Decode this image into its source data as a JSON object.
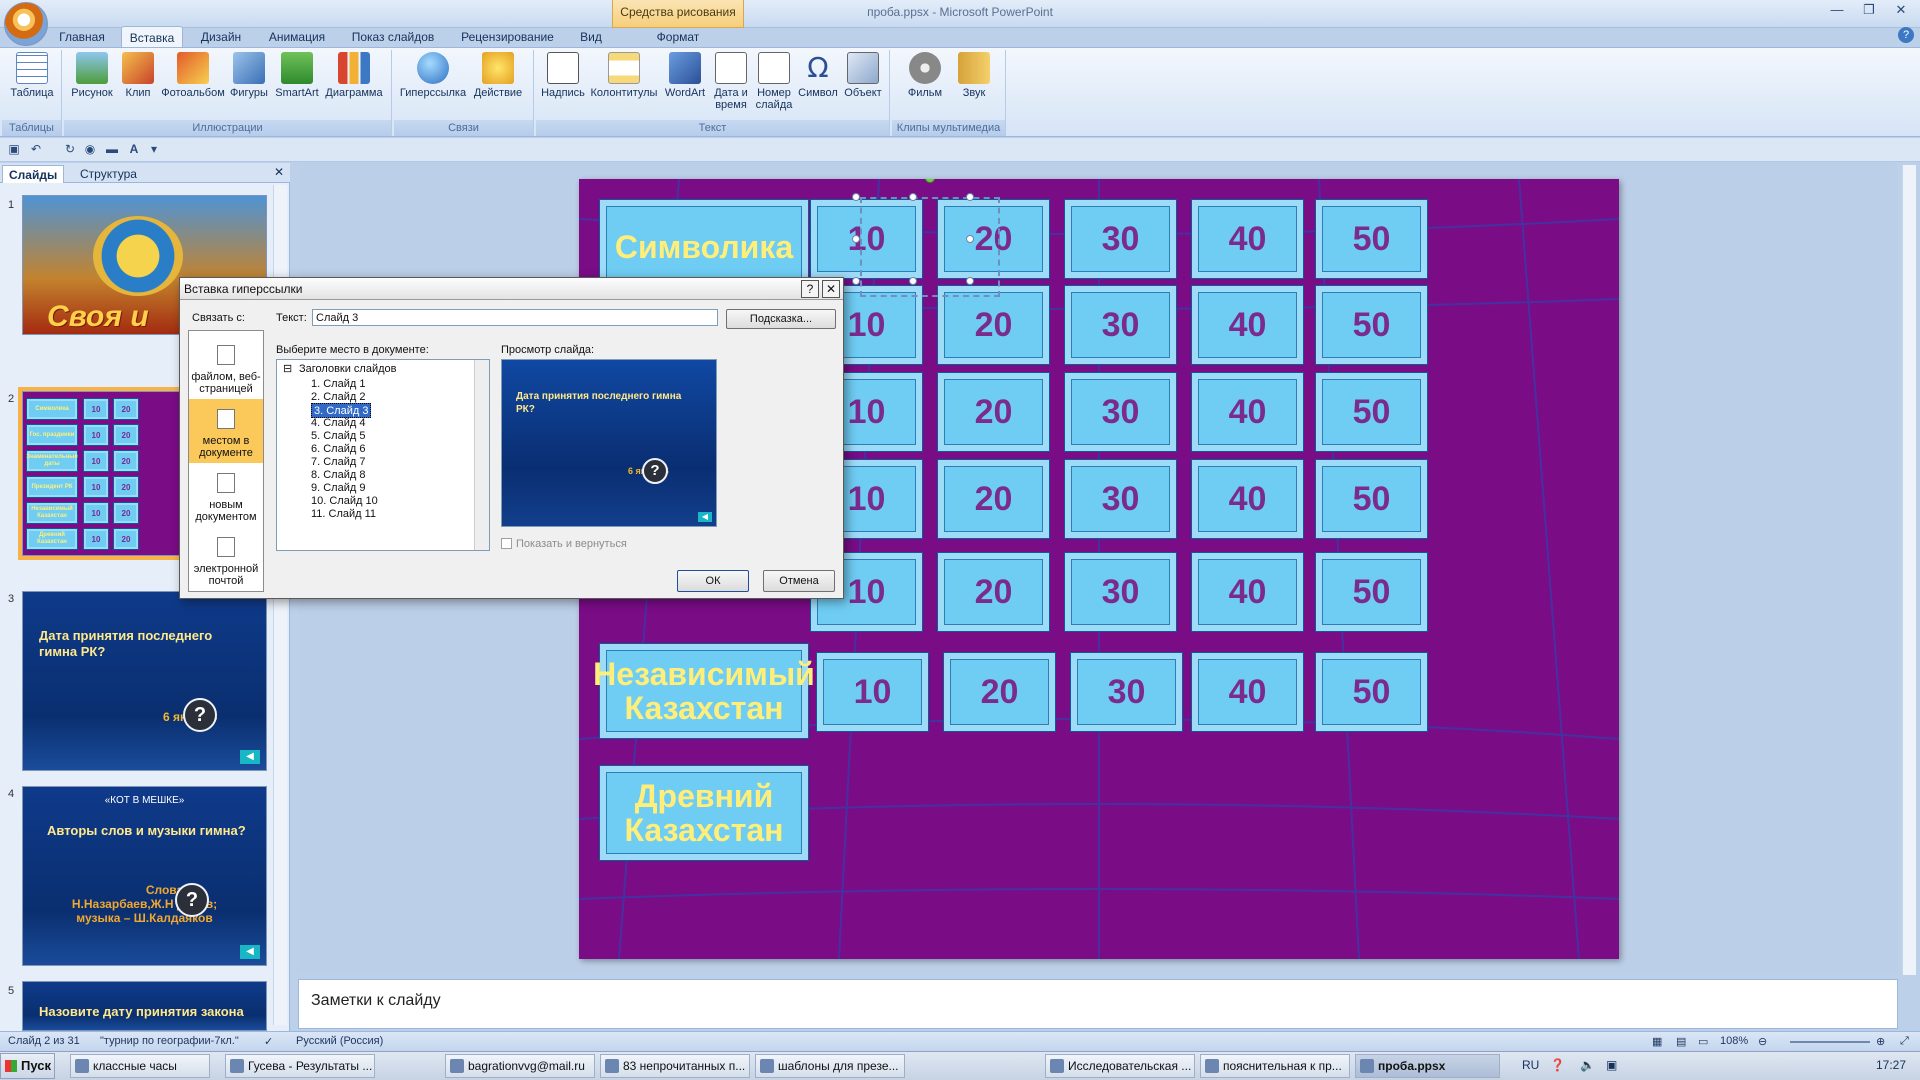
{
  "window": {
    "title": "проба.ppsx - Microsoft PowerPoint",
    "context_tab": "Средства рисования"
  },
  "tabs": [
    "Главная",
    "Вставка",
    "Дизайн",
    "Анимация",
    "Показ слайдов",
    "Рецензирование",
    "Вид",
    "Формат"
  ],
  "ribbon": {
    "groups": {
      "tables": "Таблицы",
      "illustrations": "Иллюстрации",
      "links": "Связи",
      "text": "Текст",
      "media": "Клипы мультимедиа"
    },
    "buttons": {
      "table": "Таблица",
      "picture": "Рисунок",
      "clip": "Клип",
      "photoalbum": "Фотоальбом",
      "shapes": "Фигуры",
      "smartart": "SmartArt",
      "chart": "Диаграмма",
      "hyperlink": "Гиперссылка",
      "action": "Действие",
      "textbox": "Надпись",
      "headerfooter": "Колонтитулы",
      "wordart": "WordArt",
      "datetime_1": "Дата и",
      "datetime_2": "время",
      "slidenumber_1": "Номер",
      "slidenumber_2": "слайда",
      "symbol": "Символ",
      "object": "Объект",
      "movie": "Фильм",
      "sound": "Звук"
    }
  },
  "left_pane": {
    "tabs": [
      "Слайды",
      "Структура"
    ],
    "slide1_banner": "Своя и",
    "slide2_categories": [
      "Символика",
      "Гос. праздники",
      "Знаменательные даты",
      "Президент РК",
      "Независимый Казахстан",
      "Древний Казахстан"
    ],
    "slide2_values": [
      "10",
      "20"
    ],
    "slide3_question": "Дата принятия последнего гимна РК?",
    "slide3_answer": "6 ян  2006",
    "slide4_header": "«КОТ В МЕШКЕ»",
    "slide4_question": "Авторы слов и музыки гимна?",
    "slide4_answer_1": "Слова",
    "slide4_answer_2": "Н.Назарбаев,Ж.Н      денов;",
    "slide4_answer_3": "музыка – Ш.Калдаяков",
    "slide5_text": "Назовите дату принятия закона",
    "question_mark": "?",
    "arrow_glyph": "◀"
  },
  "slide": {
    "categories": [
      "Символика",
      "Независимый Казахстан",
      "Древний Казахстан"
    ],
    "values": [
      "10",
      "20",
      "30",
      "40",
      "50"
    ]
  },
  "notes": {
    "placeholder": "Заметки к слайду"
  },
  "dialog": {
    "title": "Вставка гиперссылки",
    "help": "?",
    "close": "✕",
    "link_with": "Связать с:",
    "link_options": [
      {
        "line1": "файлом, веб-",
        "line2": "страницей"
      },
      {
        "line1": "местом в",
        "line2": "документе"
      },
      {
        "line1": "новым",
        "line2": "документом"
      },
      {
        "line1": "электронной",
        "line2": "почтой"
      }
    ],
    "text_label": "Текст:",
    "text_value": "Слайд 3",
    "screentip": "Подсказка...",
    "place_label": "Выберите место в документе:",
    "preview_label": "Просмотр слайда:",
    "tree_root": "Заголовки слайдов",
    "tree_items": [
      "1. Слайд 1",
      "2. Слайд 2",
      "3. Слайд 3",
      "4. Слайд 4",
      "5. Слайд 5",
      "6. Слайд 6",
      "7. Слайд 7",
      "8. Слайд 8",
      "9. Слайд 9",
      "10. Слайд 10",
      "11. Слайд 11"
    ],
    "preview_question": "Дата принятия последнего гимна РК?",
    "preview_answer": "6 ян  2006",
    "show_and_return": "Показать и вернуться",
    "ok": "ОК",
    "cancel": "Отмена"
  },
  "status": {
    "slide": "Слайд 2 из 31",
    "theme": "\"турнир по географии-7кл.\"",
    "language": "Русский (Россия)",
    "zoom": "108%"
  },
  "taskbar": {
    "start": "Пуск",
    "items": [
      "классные часы",
      "Гусева - Результаты ...",
      "bagrationvvg@mail.ru",
      "83 непрочитанных п...",
      "шаблоны для презе...",
      "Исследовательская ...",
      "пояснительная к пр...",
      "проба.ppsx"
    ],
    "lang": "RU",
    "time": "17:27"
  },
  "colors": {
    "slide_bg": "#7a0c86",
    "tile": "#6fcdf4",
    "category_text": "#ffef7a",
    "value_text": "#7b2b8e",
    "selected_option": "#fbc85a"
  }
}
